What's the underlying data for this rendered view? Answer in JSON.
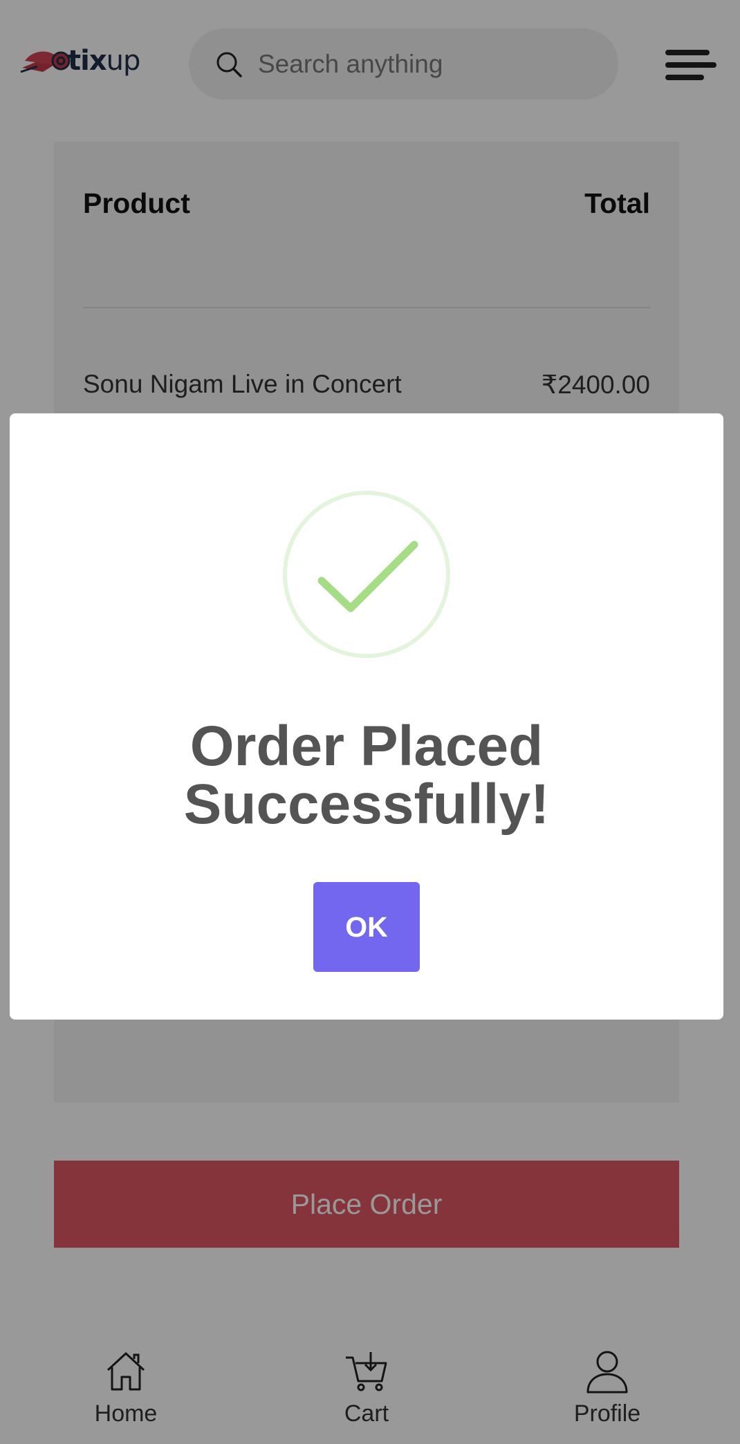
{
  "header": {
    "logo_text_bold": "tix",
    "logo_text_regular": "up",
    "search_placeholder": "Search anything",
    "search_icon": "search-icon",
    "menu_icon": "hamburger-menu-icon"
  },
  "order_table": {
    "col_product": "Product",
    "col_total": "Total",
    "items": [
      {
        "name": "Sonu Nigam Live in Concert",
        "total": "₹2400.00"
      }
    ]
  },
  "place_order_label": "Place Order",
  "modal": {
    "icon": "check-circle-icon",
    "title_line1": "Order Placed",
    "title_line2": "Successfully!",
    "ok_label": "OK"
  },
  "bottom_nav": {
    "items": [
      {
        "label": "Home",
        "icon": "home-icon"
      },
      {
        "label": "Cart",
        "icon": "cart-icon"
      },
      {
        "label": "Profile",
        "icon": "profile-icon"
      }
    ]
  },
  "colors": {
    "accent_purple": "#7367f0",
    "place_order_red": "#e05865",
    "success_green": "#a5dc86",
    "logo_red": "#c2394a",
    "logo_navy": "#1f2f4c"
  }
}
